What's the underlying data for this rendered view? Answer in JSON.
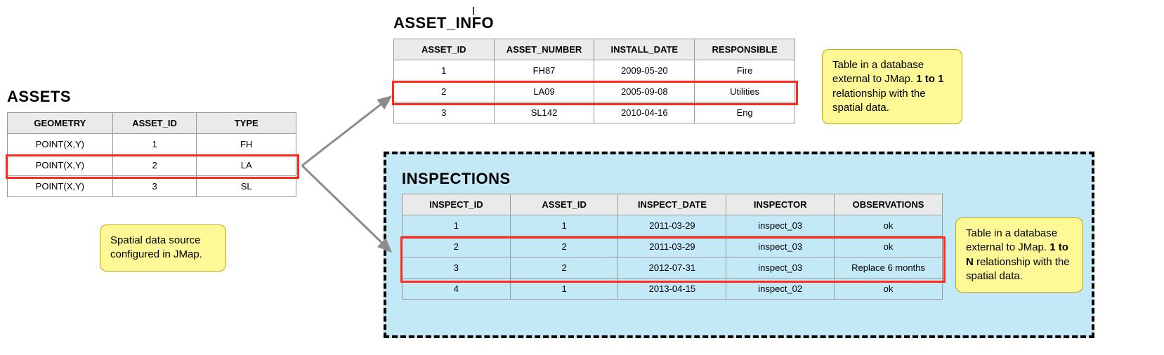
{
  "assets": {
    "title": "ASSETS",
    "headers": {
      "c0": "GEOMETRY",
      "c1": "ASSET_ID",
      "c2": "TYPE"
    },
    "rows": [
      {
        "c0": "POINT(X,Y)",
        "c1": "1",
        "c2": "FH"
      },
      {
        "c0": "POINT(X,Y)",
        "c1": "2",
        "c2": "LA"
      },
      {
        "c0": "POINT(X,Y)",
        "c1": "3",
        "c2": "SL"
      }
    ],
    "note_html": "Spatial data source configured in JMap."
  },
  "asset_info": {
    "title": "ASSET_INFO",
    "headers": {
      "c0": "ASSET_ID",
      "c1": "ASSET_NUMBER",
      "c2": "INSTALL_DATE",
      "c3": "RESPONSIBLE"
    },
    "rows": [
      {
        "c0": "1",
        "c1": "FH87",
        "c2": "2009-05-20",
        "c3": "Fire"
      },
      {
        "c0": "2",
        "c1": "LA09",
        "c2": "2005-09-08",
        "c3": "Utilities"
      },
      {
        "c0": "3",
        "c1": "SL142",
        "c2": "2010-04-16",
        "c3": "Eng"
      }
    ],
    "note_pre": "Table in a database external to JMap. ",
    "note_bold": "1 to 1",
    "note_post": " relationship with the spatial data."
  },
  "inspections": {
    "title": "INSPECTIONS",
    "headers": {
      "c0": "INSPECT_ID",
      "c1": "ASSET_ID",
      "c2": "INSPECT_DATE",
      "c3": "INSPECTOR",
      "c4": "OBSERVATIONS"
    },
    "rows": [
      {
        "c0": "1",
        "c1": "1",
        "c2": "2011-03-29",
        "c3": "inspect_03",
        "c4": "ok"
      },
      {
        "c0": "2",
        "c1": "2",
        "c2": "2011-03-29",
        "c3": "inspect_03",
        "c4": "ok"
      },
      {
        "c0": "3",
        "c1": "2",
        "c2": "2012-07-31",
        "c3": "inspect_03",
        "c4": "Replace 6 months"
      },
      {
        "c0": "4",
        "c1": "1",
        "c2": "2013-04-15",
        "c3": "inspect_02",
        "c4": "ok"
      }
    ],
    "note_pre": "Table in a database external to JMap. ",
    "note_bold": "1 to N",
    "note_post": " relationship with the spatial data."
  }
}
